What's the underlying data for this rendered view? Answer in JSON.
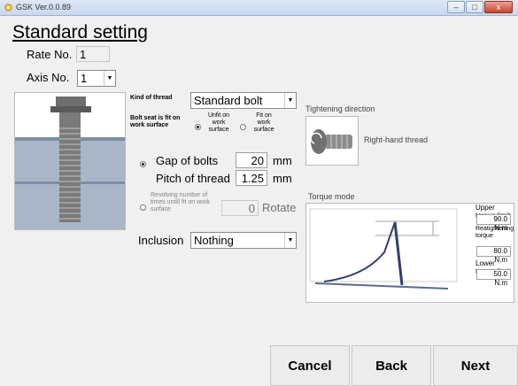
{
  "window": {
    "title": "GSK Ver.0.0.89",
    "icon": "app-icon",
    "minimize": "–",
    "maximize": "□",
    "close": "x"
  },
  "page_title": "Standard setting",
  "rate": {
    "label": "Rate No.",
    "value": "1"
  },
  "axis": {
    "label": "Axis No.",
    "value": "1"
  },
  "thread": {
    "label": "Kind of thread",
    "value": "Standard bolt"
  },
  "bolt_seat": {
    "label": "Bolt seat is fit on work surface",
    "options": [
      "Unfit on work surface",
      "Fit on work surface"
    ],
    "selected": 0
  },
  "gap": {
    "label": "Gap of bolts",
    "value": "20",
    "unit": "mm"
  },
  "pitch": {
    "label": "Pitch of thread",
    "value": "1.25",
    "unit": "mm"
  },
  "revolving": {
    "label": "Revolving number of times untill fit on work surface",
    "value": "0",
    "unit": "Rotate"
  },
  "inclusion": {
    "label": "Inclusion",
    "value": "Nothing"
  },
  "tightening": {
    "label": "Tightening direction",
    "value": "Right-hand thread"
  },
  "torque": {
    "label": "Torque mode",
    "upper_label": "Upper torque limit",
    "upper_value": "90.0",
    "upper_unit": "N.m",
    "retighten_label": "Reatightening torque",
    "retighten_value": "80.0",
    "retighten_unit": "N.m",
    "lower_label": "Lower torque limit",
    "lower_value": "50.0",
    "lower_unit": "N.m"
  },
  "buttons": {
    "cancel": "Cancel",
    "back": "Back",
    "next": "Next"
  }
}
